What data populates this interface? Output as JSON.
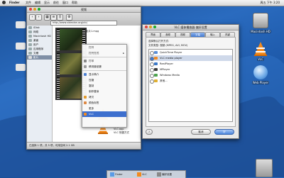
{
  "menubar": {
    "items": [
      "Finder",
      "文件",
      "编辑",
      "显示",
      "前往",
      "窗口",
      "帮助"
    ],
    "clock": "周五 下午 3:20"
  },
  "desktop": {
    "icons": [
      {
        "label": "Macintosh HD"
      },
      {
        "label": "VLC"
      },
      {
        "label": "Web Player"
      }
    ]
  },
  "finder": {
    "title": "视频",
    "search_value": "http://www.videolan.org/vlc/",
    "sidebar": [
      {
        "label": "iDisk"
      },
      {
        "label": "网络"
      },
      {
        "label": "Macintosh HD"
      },
      {
        "label": "桌面"
      },
      {
        "label": "用户"
      },
      {
        "label": "应用程序"
      },
      {
        "label": "文稿"
      },
      {
        "label": "影片"
      }
    ],
    "files": [
      {
        "name": "影片1.mpg"
      },
      {
        "name": "影片2.avi"
      },
      {
        "name": "影片3.mov"
      },
      {
        "name": "VLC.app"
      },
      {
        "name": "VLC 快捷方式"
      }
    ],
    "status": "已选择 1 项，共 5 项，可用空间 2.1 GB"
  },
  "context_menu": {
    "items": [
      {
        "label": "打开"
      },
      {
        "label": "打开方式"
      },
      {
        "label": "打印"
      },
      {
        "label": "移到废纸篓"
      },
      {
        "label": "显示简介"
      },
      {
        "label": "压缩"
      },
      {
        "label": "复制"
      },
      {
        "label": "制作替身"
      },
      {
        "label": "拷贝"
      },
      {
        "label": "颜色标签"
      },
      {
        "label": "更多"
      },
      {
        "label": "VLC"
      }
    ],
    "highlighted": "VLC"
  },
  "prefs": {
    "title": "VLC 媒体播放器 偏好设置",
    "tabs": [
      "界面",
      "音频",
      "视频",
      "字幕",
      "输入",
      "热键"
    ],
    "selected_tab": "字幕",
    "header_text": "选择默认打开方式:",
    "sub_text": "文件类型: 视频 (MPEG, AVI, MOV)",
    "options": [
      {
        "label": "QuickTime Player",
        "color": "#5a8fd8"
      },
      {
        "label": "VLC media player",
        "color": "#f08a24"
      },
      {
        "label": "RealPlayer",
        "color": "#3a78c8"
      },
      {
        "label": "MPlayer",
        "color": "#3a3a3a"
      },
      {
        "label": "Windows Media",
        "color": "#4ea44e"
      },
      {
        "label": "其他...",
        "color": "#e0b030"
      }
    ],
    "selected_option": "VLC media player",
    "buttons": {
      "cancel": "取消",
      "ok": "好"
    }
  },
  "dock": {
    "items": [
      {
        "label": "Finder"
      },
      {
        "label": "VLC"
      },
      {
        "label": "偏好设置"
      }
    ]
  },
  "colors": {
    "desktop_bg": "#1d58a8",
    "highlight": "#3d6fce",
    "selected_tab": "#3f77d0"
  }
}
